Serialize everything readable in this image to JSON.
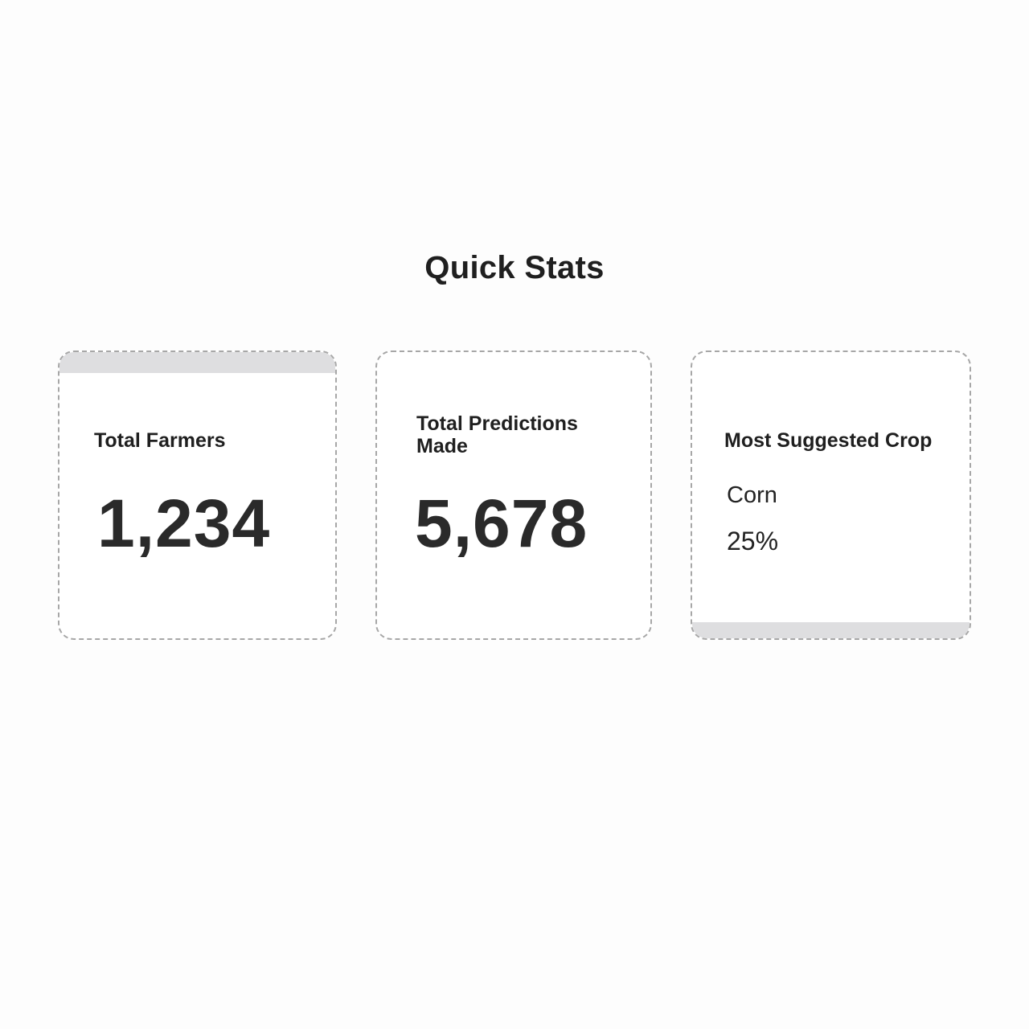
{
  "section": {
    "title": "Quick Stats"
  },
  "cards": [
    {
      "label": "Total Farmers",
      "value": "1,234"
    },
    {
      "label": "Total Predictions Made",
      "value": "5,678"
    },
    {
      "label": "Most Suggested Crop",
      "crop": "Corn",
      "percentage": "25%"
    }
  ],
  "colors": {
    "background": "#fdfdfd",
    "card_border": "#a7a7a7",
    "card_band": "#dedee0",
    "text": "#222222"
  }
}
